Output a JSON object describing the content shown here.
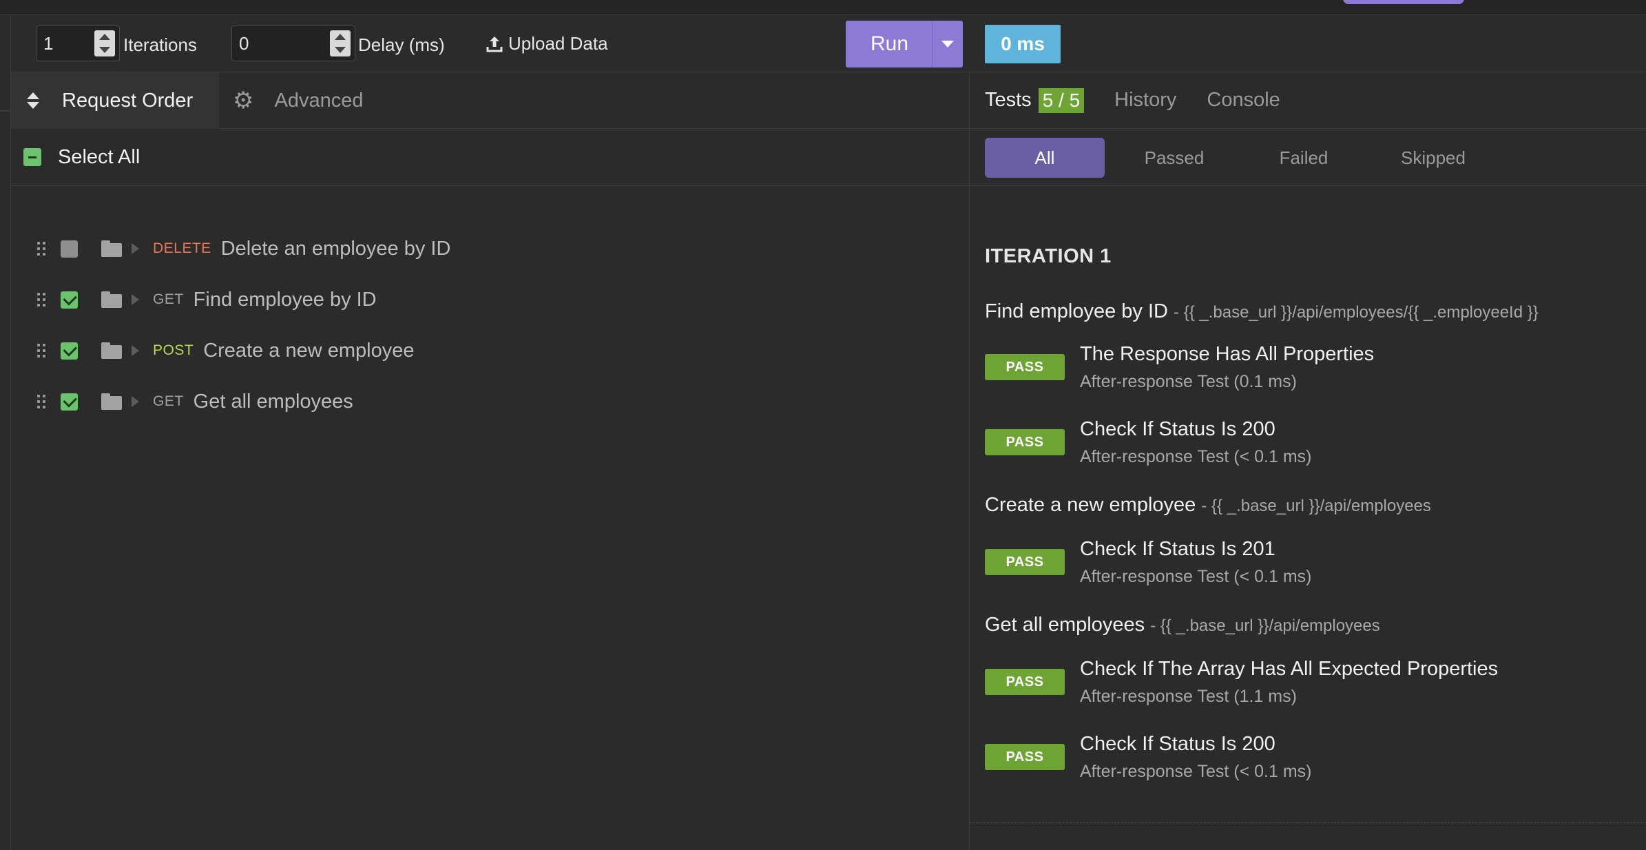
{
  "toolbar": {
    "iterations_value": "1",
    "iterations_label": "Iterations",
    "delay_value": "0",
    "delay_label": "Delay (ms)",
    "upload_label": "Upload Data",
    "run_label": "Run"
  },
  "left_tabs": {
    "request_order": "Request Order",
    "advanced": "Advanced"
  },
  "select_all_label": "Select All",
  "requests": [
    {
      "method": "DELETE",
      "name": "Delete an employee by ID",
      "checked": false
    },
    {
      "method": "GET",
      "name": "Find employee by ID",
      "checked": true
    },
    {
      "method": "POST",
      "name": "Create a new employee",
      "checked": true
    },
    {
      "method": "GET",
      "name": "Get all employees",
      "checked": true
    }
  ],
  "right": {
    "time_badge": "0 ms",
    "tabs": {
      "tests": "Tests",
      "tests_count": "5 / 5",
      "history": "History",
      "console": "Console"
    },
    "filters": {
      "all": "All",
      "passed": "Passed",
      "failed": "Failed",
      "skipped": "Skipped"
    },
    "iteration_title": "ITERATION 1",
    "groups": [
      {
        "name": "Find employee by ID",
        "url": "- {{ _.base_url }}/api/employees/{{ _.employeeId }}",
        "tests": [
          {
            "badge": "PASS",
            "name": "The Response Has All Properties",
            "detail": "After-response Test (0.1 ms)"
          },
          {
            "badge": "PASS",
            "name": "Check If Status Is 200",
            "detail": "After-response Test (< 0.1 ms)"
          }
        ]
      },
      {
        "name": "Create a new employee",
        "url": "- {{ _.base_url }}/api/employees",
        "tests": [
          {
            "badge": "PASS",
            "name": "Check If Status Is 201",
            "detail": "After-response Test (< 0.1 ms)"
          }
        ]
      },
      {
        "name": "Get all employees",
        "url": "- {{ _.base_url }}/api/employees",
        "tests": [
          {
            "badge": "PASS",
            "name": "Check If The Array Has All Expected Properties",
            "detail": "After-response Test (1.1 ms)"
          },
          {
            "badge": "PASS",
            "name": "Check If Status Is 200",
            "detail": "After-response Test (< 0.1 ms)"
          }
        ]
      }
    ]
  },
  "colors": {
    "accent": "#8c7ad6",
    "pass": "#6da434",
    "delete": "#e8734f",
    "post": "#b7d94a",
    "time_badge": "#5fb4dc"
  }
}
